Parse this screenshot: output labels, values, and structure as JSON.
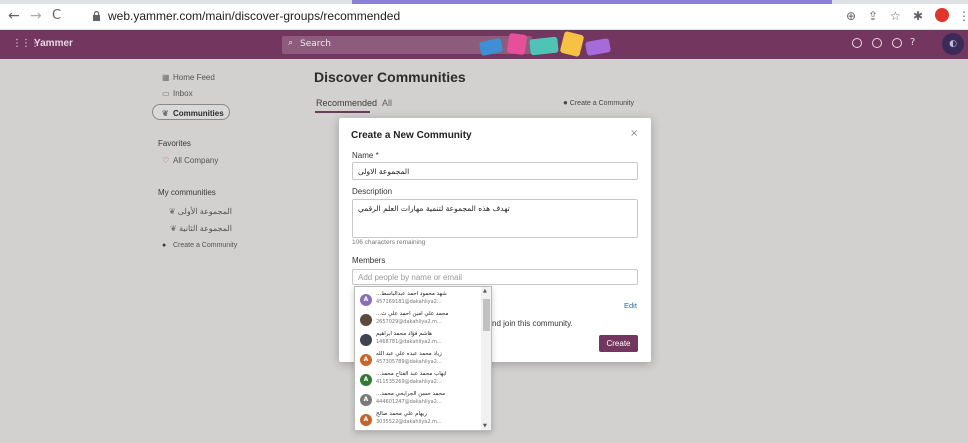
{
  "browser": {
    "url": "web.yammer.com/main/discover-groups/recommended",
    "back": "←",
    "forward": "→",
    "reload": "C"
  },
  "header": {
    "brand": "Yammer",
    "search_placeholder": "Search"
  },
  "sidebar": {
    "nav": [
      {
        "label": "Home Feed"
      },
      {
        "label": "Inbox"
      },
      {
        "label": "Communities"
      }
    ],
    "favorites_heading": "Favorites",
    "favorites": [
      {
        "label": "All Company"
      }
    ],
    "my_heading": "My communities",
    "my_communities": [
      {
        "label": "المجموعة الأولى"
      },
      {
        "label": "المجموعة الثانية"
      }
    ],
    "create_label": "Create a Community"
  },
  "main": {
    "title": "Discover Communities",
    "tabs": [
      {
        "label": "Recommended"
      },
      {
        "label": "All"
      }
    ],
    "create_link": "Create a Community"
  },
  "dialog": {
    "title": "Create a New Community",
    "close": "×",
    "name_label": "Name *",
    "name_value": "المجموعة الاولى",
    "description_label": "Description",
    "description_value": "تهدف هذه المجموعة لتنمية مهارات العلم الرقمي",
    "chars_remaining": "106 characters remaining",
    "members_label": "Members",
    "members_placeholder": "Add people by name or email",
    "edit_label": "Edit",
    "join_text": "nd join this community.",
    "create_button": "Create"
  },
  "dropdown": {
    "items": [
      {
        "name": "شهد محمود أحمد عبدالباسط...",
        "email": "457169181@dakahliya2...",
        "avatar": "A",
        "color": "#8a6fb8"
      },
      {
        "name": "محمد علي امين احمد علي ت...",
        "email": "2657029@dakahliya2.m...",
        "avatar": "",
        "color": "#5a4a3c"
      },
      {
        "name": "هاشم فؤاد محمد ابراهيم",
        "email": "1468781@dakahliya2.m...",
        "avatar": "",
        "color": "#3d4450"
      },
      {
        "name": "زياد محمد عبده علي عبد الله",
        "email": "457305789@dakahliya2...",
        "avatar": "A",
        "color": "#c8642c"
      },
      {
        "name": "ايهاب محمد عبد الفتاح محمد...",
        "email": "411535269@dakahliya2...",
        "avatar": "A",
        "color": "#2f7a33"
      },
      {
        "name": "محمد حسن الجرايحي محمد...",
        "email": "444601247@dakahliya2...",
        "avatar": "A",
        "color": "#7a7a7a"
      },
      {
        "name": "ريهام علي محمد صالح",
        "email": "3035522@dakahliya2.m...",
        "avatar": "A",
        "color": "#c0652c"
      }
    ]
  },
  "colors": {
    "brand": "#73365e",
    "link": "#2b6cb0"
  }
}
